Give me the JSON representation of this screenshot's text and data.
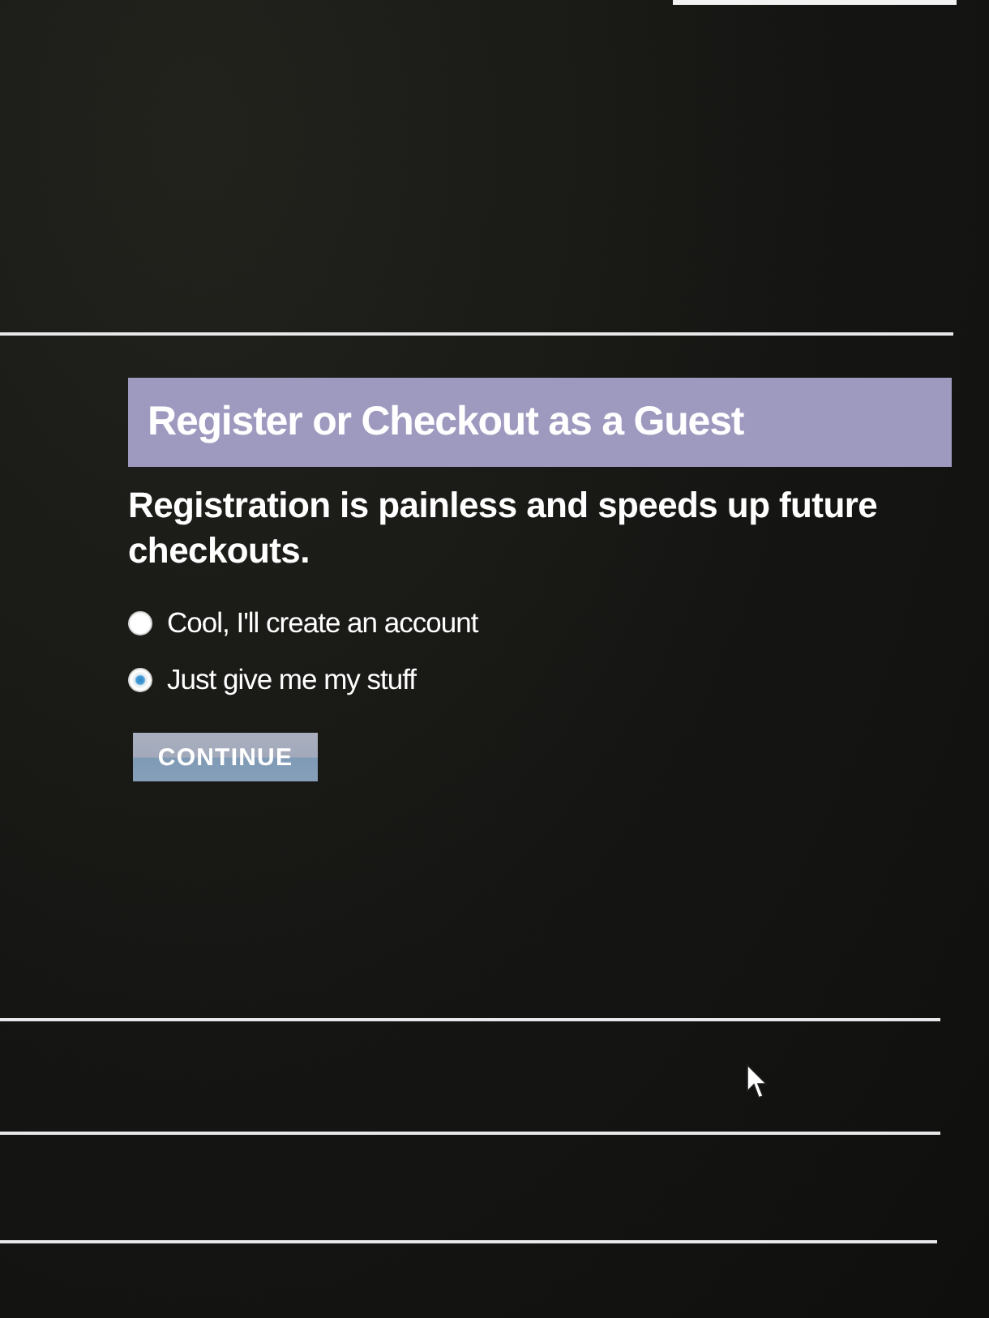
{
  "header": {
    "title": "Register or Checkout as a Guest"
  },
  "intro": "Registration is painless and speeds up future checkouts.",
  "options": [
    {
      "label": "Cool, I'll create an account",
      "selected": false
    },
    {
      "label": "Just give me my stuff",
      "selected": true
    }
  ],
  "continue_button": {
    "label": "CONTINUE"
  }
}
